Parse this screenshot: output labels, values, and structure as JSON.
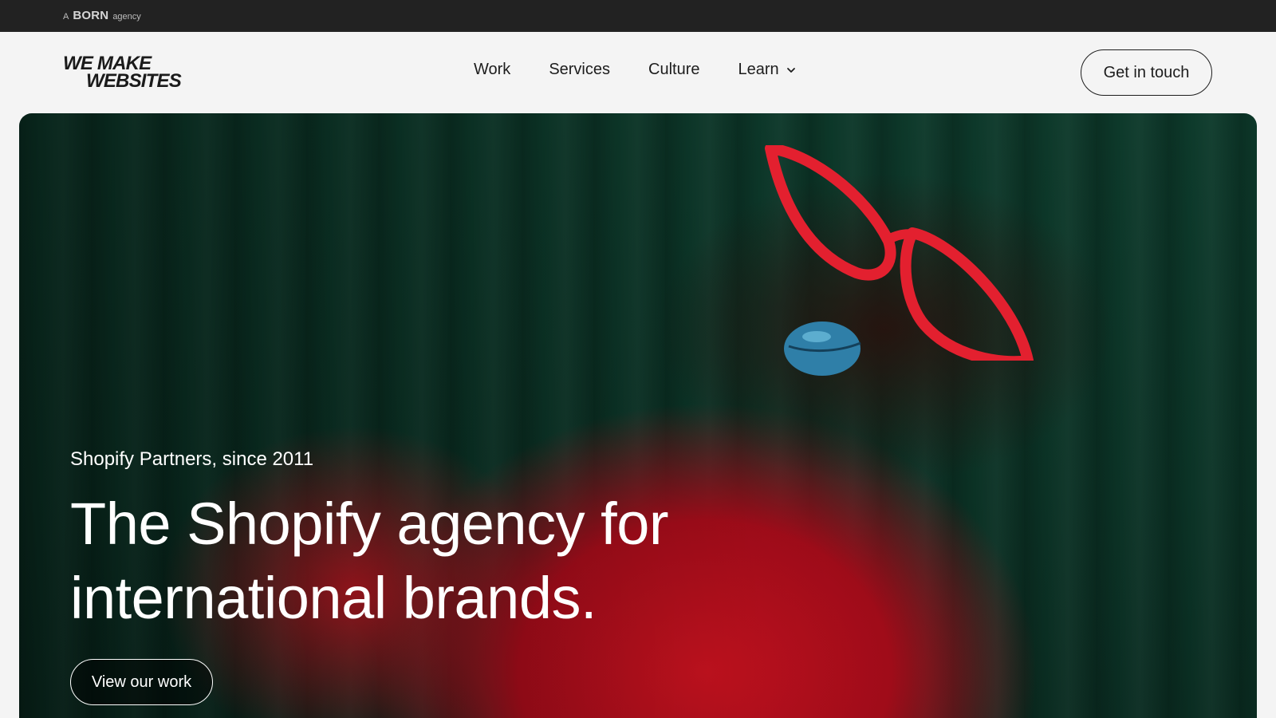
{
  "topbar": {
    "prefix": "A",
    "brand": "BORN",
    "suffix": "agency"
  },
  "logo": {
    "line1": "WE MAKE",
    "line2": "WEBSITES"
  },
  "nav": {
    "items": [
      {
        "label": "Work"
      },
      {
        "label": "Services"
      },
      {
        "label": "Culture"
      },
      {
        "label": "Learn",
        "icon": "chevron-down-icon"
      }
    ],
    "cta_label": "Get in touch"
  },
  "hero": {
    "eyebrow": "Shopify Partners, since 2011",
    "headline": "The Shopify agency for international brands.",
    "button_label": "View our work"
  },
  "colors": {
    "topbar_bg": "#222222",
    "page_bg": "#f4f4f4",
    "text": "#1d1d1d",
    "hero_green": "#0d3a2b",
    "hero_red": "#c8121f",
    "accent_blue": "#3aa6d6"
  }
}
